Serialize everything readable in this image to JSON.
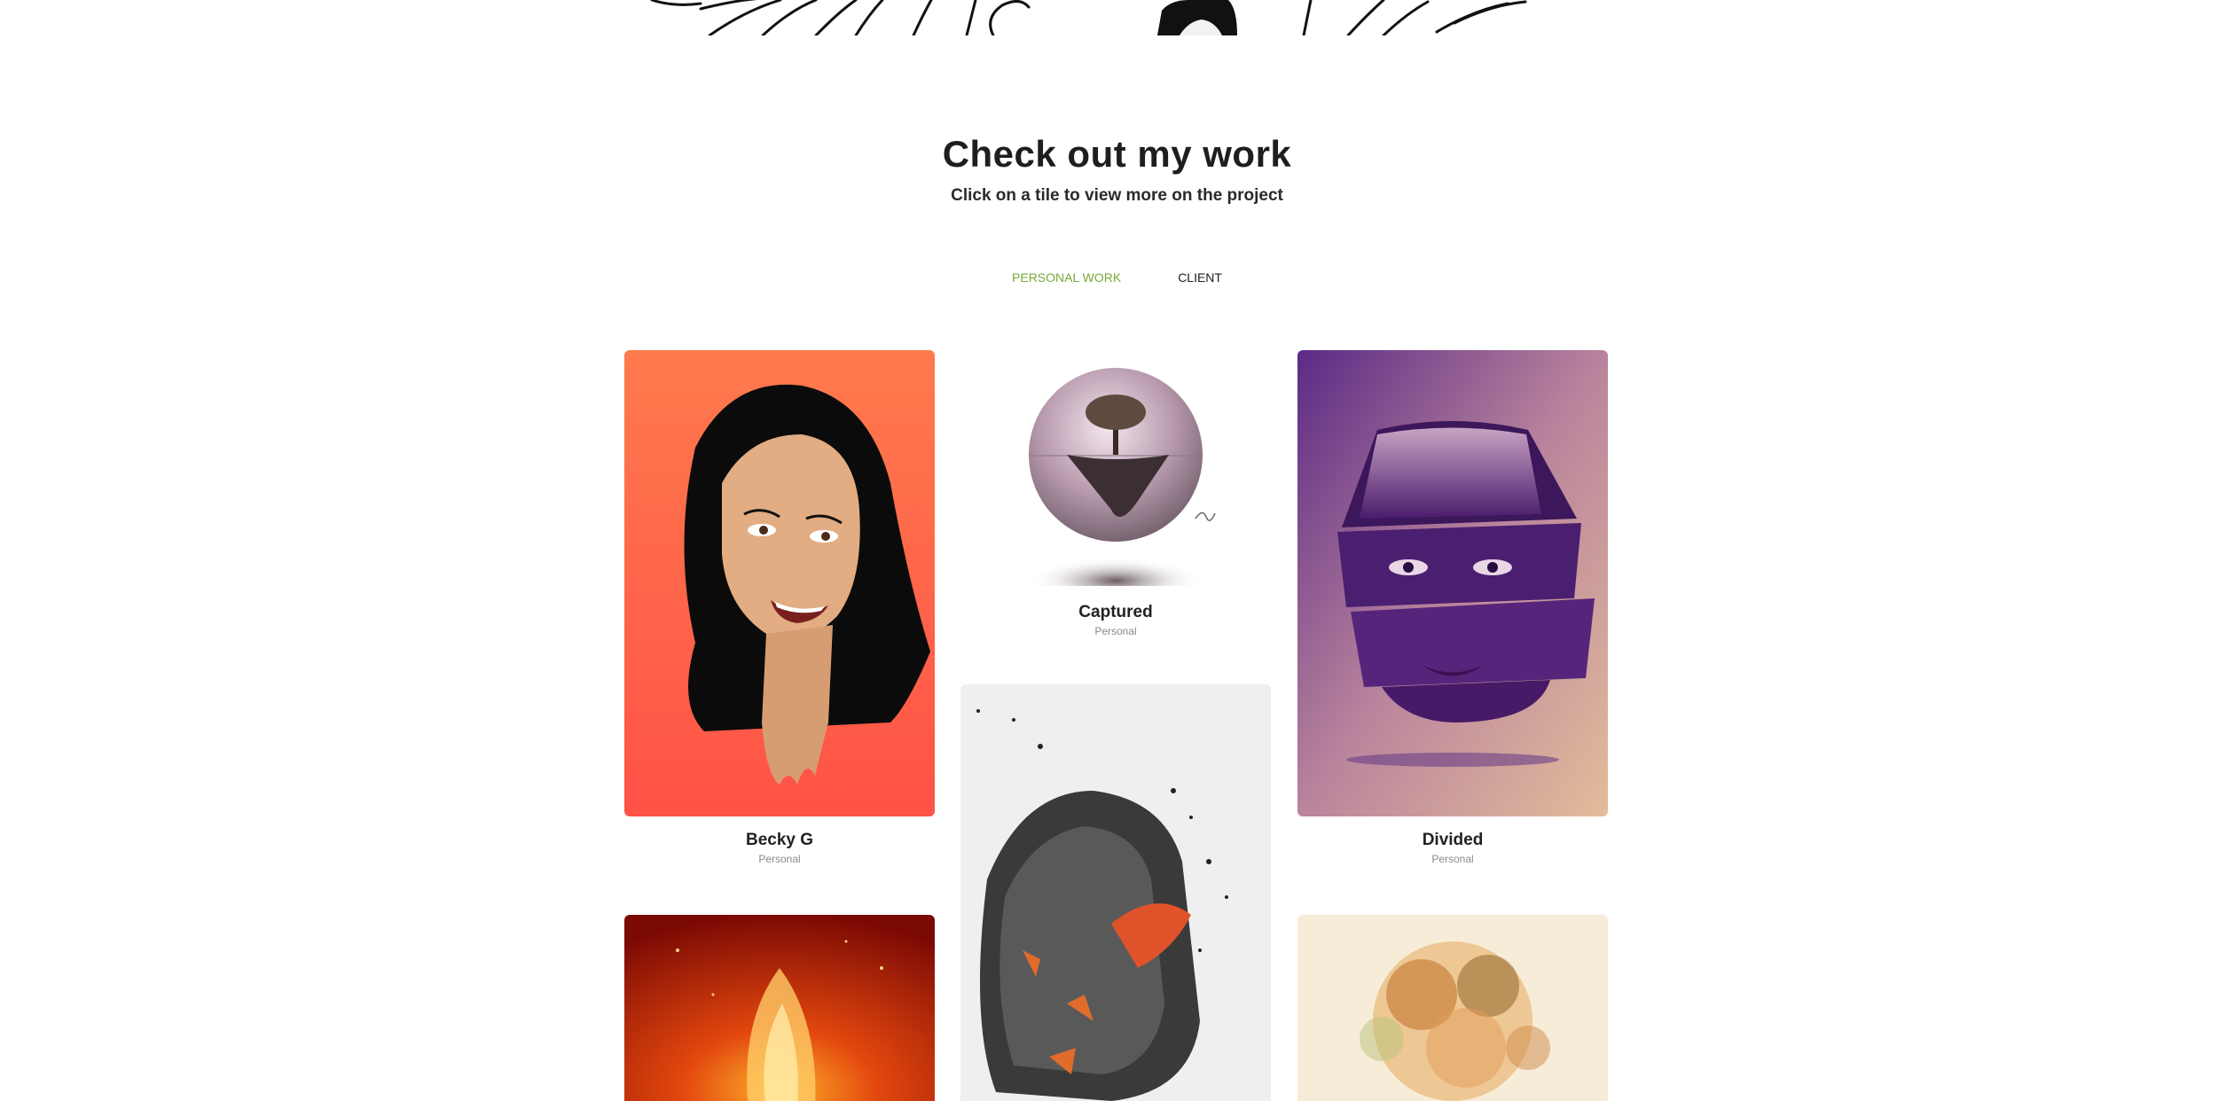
{
  "heading": {
    "title": "Check out my work",
    "subtitle": "Click on a tile to view more on the project"
  },
  "tabs": [
    {
      "label": "PERSONAL WORK",
      "active": true
    },
    {
      "label": "CLIENT",
      "active": false
    }
  ],
  "tiles": [
    {
      "name": "Becky G",
      "category": "Personal"
    },
    {
      "name": "Captured",
      "category": "Personal"
    },
    {
      "name": "Divided",
      "category": "Personal"
    },
    {
      "name": "",
      "category": ""
    },
    {
      "name": "",
      "category": ""
    },
    {
      "name": "",
      "category": ""
    }
  ],
  "colors": {
    "accent": "#7aa83a",
    "text": "#1e1e1e",
    "muted": "#8a8a8a"
  }
}
